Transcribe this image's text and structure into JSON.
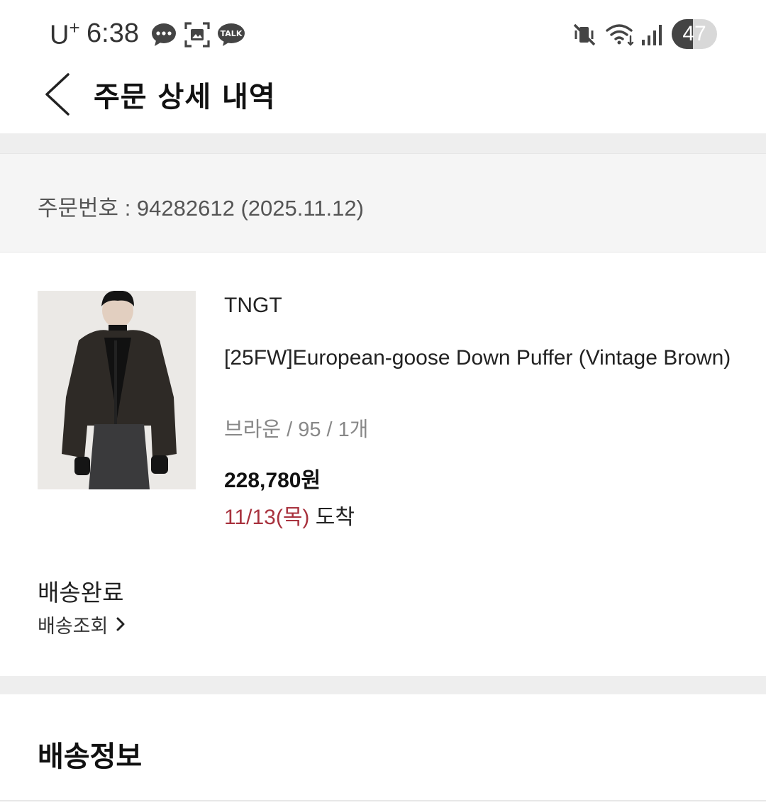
{
  "status_bar": {
    "carrier": "U",
    "carrier_sup": "+",
    "time": "6:38",
    "talk_label": "TALK",
    "battery": "47",
    "battery_level": 0.47
  },
  "header": {
    "title": "주문 상세 내역"
  },
  "order": {
    "number_text": "주문번호 : 94282612 (2025.11.12)"
  },
  "product": {
    "brand": "TNGT",
    "name": "[25FW]European-goose Down Puffer (Vintage Brown)",
    "option": "브라운 / 95 / 1개",
    "price": "228,780원",
    "arrival_date": "11/13(목)",
    "arrival_label": " 도착"
  },
  "delivery": {
    "status": "배송완료",
    "tracking_label": "배송조회"
  },
  "shipping_info": {
    "title": "배송정보"
  },
  "colors": {
    "accent_red": "#a8323e",
    "band_gray": "#eeeeee"
  },
  "icons": [
    "chat-bubble-icon",
    "screenshot-icon",
    "talk-icon",
    "mute-vibrate-icon",
    "wifi-icon",
    "signal-icon",
    "back-arrow-icon",
    "chevron-right-icon"
  ]
}
